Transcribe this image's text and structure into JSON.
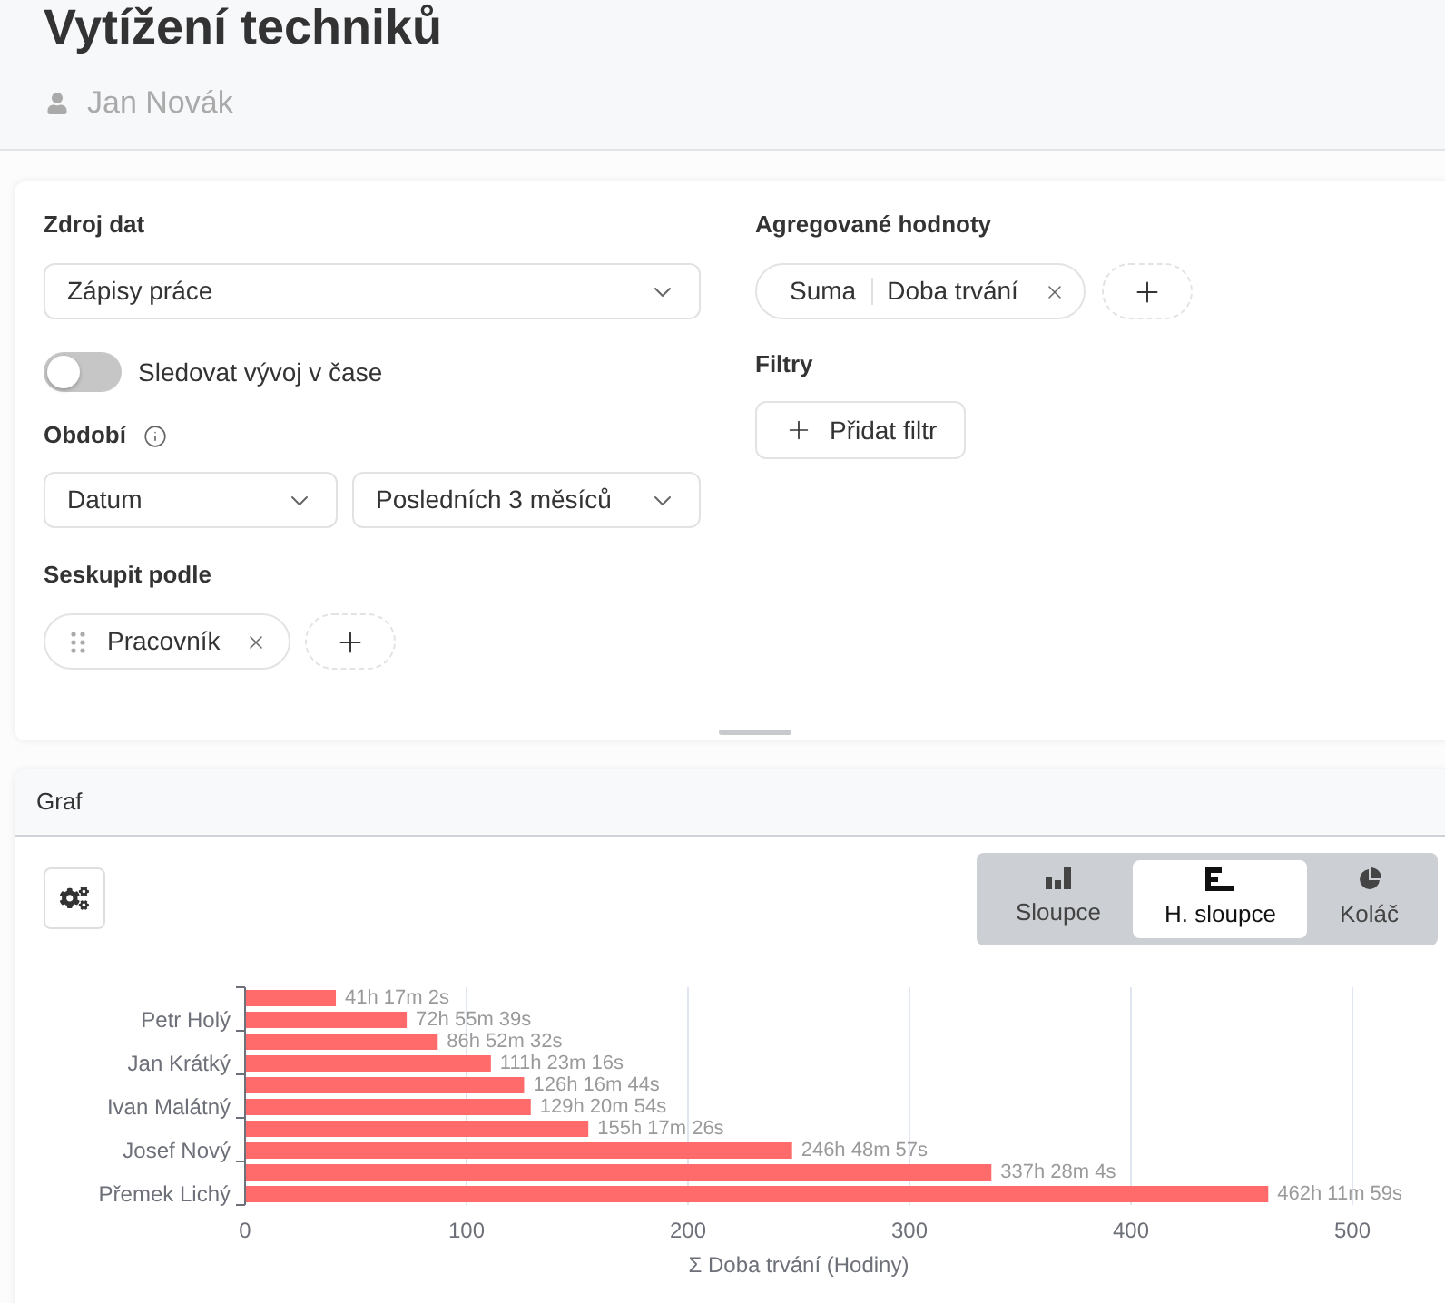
{
  "header": {
    "title": "Vytížení techniků",
    "user": "Jan Novák"
  },
  "config": {
    "data_source": {
      "label": "Zdroj dat",
      "value": "Zápisy práce"
    },
    "track_over_time": {
      "label": "Sledovat vývoj v čase",
      "on": false
    },
    "period": {
      "label": "Období",
      "field": "Datum",
      "range": "Posledních 3 měsíců"
    },
    "group_by": {
      "label": "Seskupit podle",
      "chips": [
        "Pracovník"
      ]
    },
    "aggregates": {
      "label": "Agregované hodnoty",
      "chips": [
        {
          "function": "Suma",
          "field": "Doba trvání"
        }
      ]
    },
    "filters": {
      "label": "Filtry",
      "add_button": "Přidat filtr"
    }
  },
  "chart_panel": {
    "title": "Graf",
    "chart_types": [
      {
        "label": "Sloupce",
        "kind": "bar",
        "selected": false
      },
      {
        "label": "H. sloupce",
        "kind": "hbar",
        "selected": true
      },
      {
        "label": "Koláč",
        "kind": "pie",
        "selected": false
      }
    ],
    "chart_data": {
      "type": "bar",
      "orientation": "horizontal",
      "grid": true,
      "xlabel": "Σ Doba trvání (Hodiny)",
      "categories": [
        null,
        "Petr Holý",
        null,
        "Jan Krátký",
        null,
        "Ivan Malátný",
        null,
        "Josef Nový",
        null,
        "Přemek Lichý"
      ],
      "series": [
        {
          "color": "#ff6b6b",
          "values": [
            41,
            73,
            87,
            111,
            126,
            129,
            155,
            247,
            337,
            462
          ]
        }
      ],
      "xlim": [
        0,
        500
      ],
      "xticks": [
        0,
        100,
        200,
        300,
        400,
        500
      ],
      "value_labels": [
        "41h 17m 2s",
        "72h 55m 39s",
        "86h 52m 32s",
        "111h 23m 16s",
        "126h 16m 44s",
        "129h 20m 54s",
        "155h 17m 26s",
        "246h 48m 57s",
        "337h 28m 4s",
        "462h 11m 59s"
      ]
    }
  }
}
